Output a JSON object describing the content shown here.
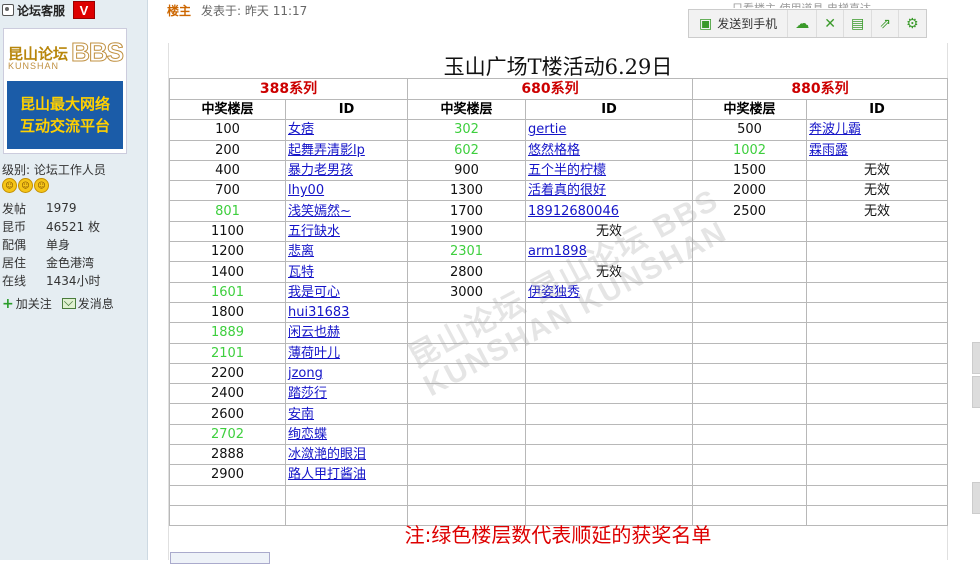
{
  "sidebar": {
    "author_name": "论坛客服",
    "badge": "V",
    "avatar": {
      "logo_cn": "昆山论坛",
      "logo_en": "KUNSHAN",
      "logo_bbs": "BBS",
      "line1": "昆山最大网络",
      "line2": "互动交流平台"
    },
    "level": "级别: 论坛工作人员",
    "stats": [
      {
        "key": "发帖",
        "value": "1979"
      },
      {
        "key": "昆币",
        "value": "46521 枚"
      },
      {
        "key": "配偶",
        "value": "单身"
      },
      {
        "key": "居住",
        "value": "金色港湾"
      },
      {
        "key": "在线",
        "value": "1434小时"
      }
    ],
    "follow_label": "加关注",
    "message_label": "发消息"
  },
  "post": {
    "floor_label": "楼主",
    "posted": "发表于: 昨天 11:17",
    "meta_right": "只看楼主  使用道具  电梯直达"
  },
  "toolbar": {
    "send_label": "发送到手机"
  },
  "board": {
    "title": "玉山广场T楼活动6.29日",
    "series": [
      "388系列",
      "680系列",
      "880系列"
    ],
    "col_floor": "中奖楼层",
    "col_id": "ID",
    "rows": [
      [
        {
          "f": "100",
          "g": false,
          "id": "女痞"
        },
        {
          "f": "302",
          "g": true,
          "id": "gertie"
        },
        {
          "f": "500",
          "g": false,
          "id": "奔波儿霸"
        }
      ],
      [
        {
          "f": "200",
          "g": false,
          "id": "起舞弄清影lp"
        },
        {
          "f": "602",
          "g": true,
          "id": "悠然格格"
        },
        {
          "f": "1002",
          "g": true,
          "id": "霖雨露"
        }
      ],
      [
        {
          "f": "400",
          "g": false,
          "id": "暴力老男孩"
        },
        {
          "f": "900",
          "g": false,
          "id": "五个半的柠檬"
        },
        {
          "f": "1500",
          "g": false,
          "na": "无效"
        }
      ],
      [
        {
          "f": "700",
          "g": false,
          "id": "lhy00"
        },
        {
          "f": "1300",
          "g": false,
          "id": "活着真的很好"
        },
        {
          "f": "2000",
          "g": false,
          "na": "无效"
        }
      ],
      [
        {
          "f": "801",
          "g": true,
          "id": "浅笑嫣然~"
        },
        {
          "f": "1700",
          "g": false,
          "id": "18912680046"
        },
        {
          "f": "2500",
          "g": false,
          "na": "无效"
        }
      ],
      [
        {
          "f": "1100",
          "g": false,
          "id": "五行缺水"
        },
        {
          "f": "1900",
          "g": false,
          "na": "无效"
        },
        {}
      ],
      [
        {
          "f": "1200",
          "g": false,
          "id": "悲离"
        },
        {
          "f": "2301",
          "g": true,
          "id": "arm1898"
        },
        {}
      ],
      [
        {
          "f": "1400",
          "g": false,
          "id": "瓦特"
        },
        {
          "f": "2800",
          "g": false,
          "na": "无效"
        },
        {}
      ],
      [
        {
          "f": "1601",
          "g": true,
          "id": "我是可心"
        },
        {
          "f": "3000",
          "g": false,
          "id": "伊姿独秀"
        },
        {}
      ],
      [
        {
          "f": "1800",
          "g": false,
          "id": "hui31683"
        },
        {},
        {}
      ],
      [
        {
          "f": "1889",
          "g": true,
          "id": "闲云也赫"
        },
        {},
        {}
      ],
      [
        {
          "f": "2101",
          "g": true,
          "id": "薄荷叶儿"
        },
        {},
        {}
      ],
      [
        {
          "f": "2200",
          "g": false,
          "id": "jzong"
        },
        {},
        {}
      ],
      [
        {
          "f": "2400",
          "g": false,
          "id": "踏莎行"
        },
        {},
        {}
      ],
      [
        {
          "f": "2600",
          "g": false,
          "id": "安南"
        },
        {},
        {}
      ],
      [
        {
          "f": "2702",
          "g": true,
          "id": "绚恋蝶"
        },
        {},
        {}
      ],
      [
        {
          "f": "2888",
          "g": false,
          "id": "冰潋滟的眼泪"
        },
        {},
        {}
      ],
      [
        {
          "f": "2900",
          "g": false,
          "id": "路人甲打酱油"
        },
        {},
        {}
      ],
      [
        {},
        {},
        {}
      ],
      [
        {},
        {},
        {}
      ]
    ],
    "watermark1": "昆山论坛 昆山论坛 BBS",
    "watermark2": "KUNSHAN KUNSHAN",
    "note": "注:绿色楼层数代表顺延的获奖名单"
  },
  "colors": {
    "series_red": "#cc0000",
    "green_floor": "#3ecf3e",
    "link_blue": "#1515c8",
    "avatar_blue": "#1b5ca8",
    "avatar_yellow": "#ffd000"
  }
}
